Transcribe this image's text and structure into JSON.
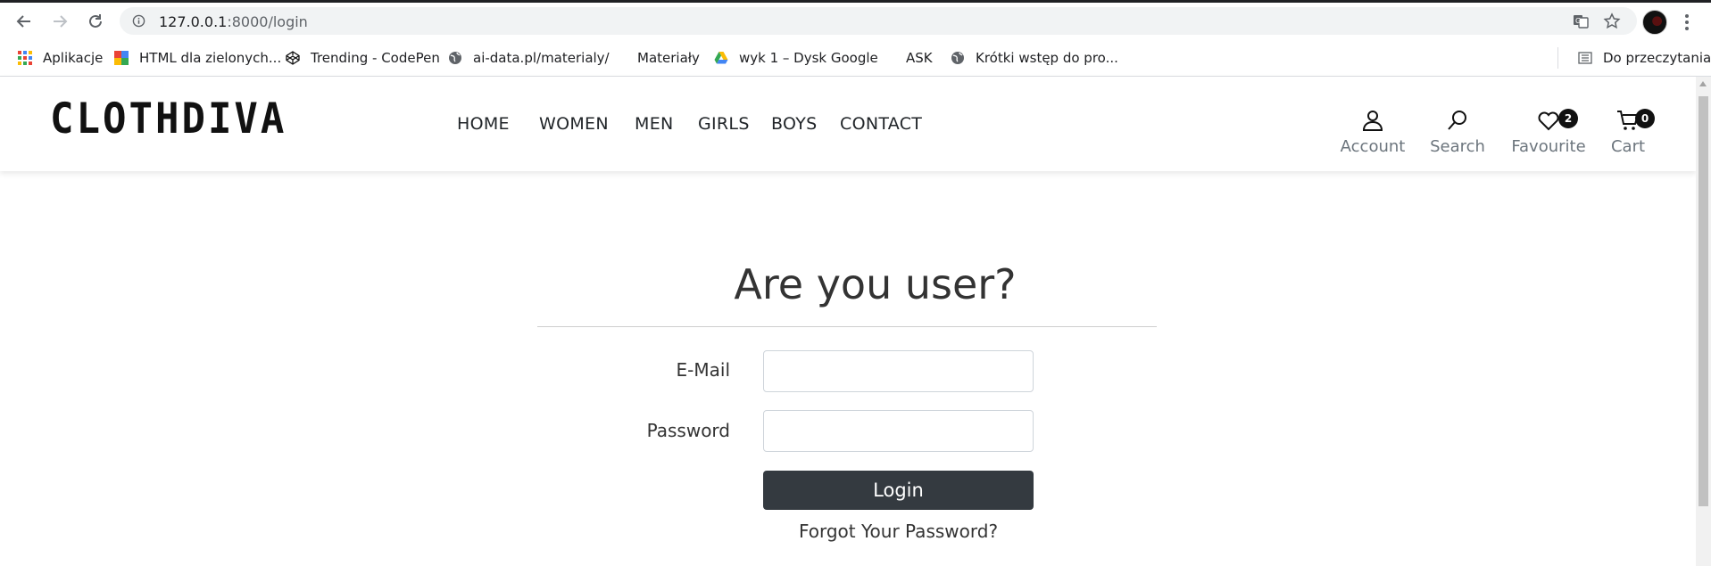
{
  "browser": {
    "url_host": "127.0.0.1",
    "url_rest": ":8000/login",
    "bookmarks": [
      {
        "label": "Aplikacje",
        "icon": "apps-grid-icon"
      },
      {
        "label": "HTML dla zielonych...",
        "icon": "site-favicon-icon"
      },
      {
        "label": "Trending - CodePen",
        "icon": "codepen-icon"
      },
      {
        "label": "ai-data.pl/materialy/",
        "icon": "globe-icon"
      },
      {
        "label": "Materiały",
        "icon": "folder-icon"
      },
      {
        "label": "wyk 1 – Dysk Google",
        "icon": "google-drive-icon"
      },
      {
        "label": "ASK",
        "icon": "folder-icon"
      },
      {
        "label": "Krótki wstęp do pro...",
        "icon": "globe-icon"
      }
    ],
    "reading_list": "Do przeczytania"
  },
  "site": {
    "logo": "CLOTHDIVA",
    "nav": [
      "HOME",
      "WOMEN",
      "MEN",
      "GIRLS",
      "BOYS",
      "CONTACT"
    ],
    "header_actions": {
      "account": "Account",
      "search": "Search",
      "favourite": "Favourite",
      "favourite_count": "2",
      "cart": "Cart",
      "cart_count": "0"
    }
  },
  "login": {
    "title": "Are you user?",
    "email_label": "E-Mail",
    "email_value": "",
    "password_label": "Password",
    "password_value": "",
    "button": "Login",
    "forgot": "Forgot Your Password?"
  }
}
